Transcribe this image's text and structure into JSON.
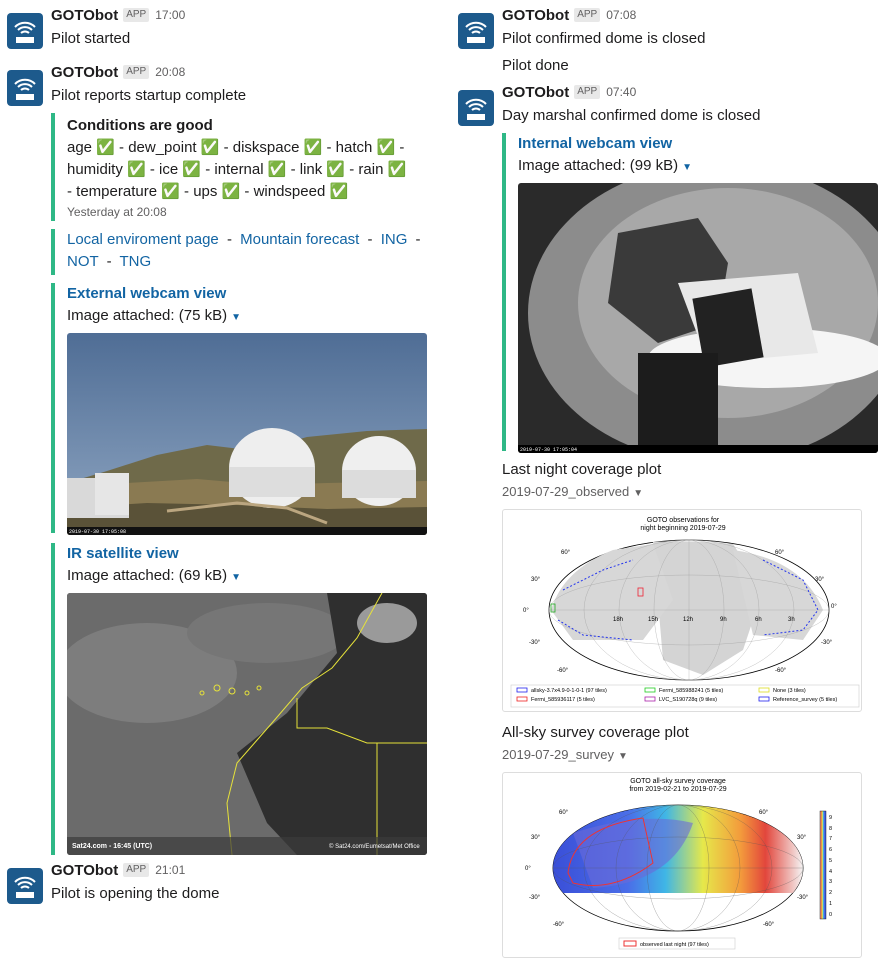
{
  "bot": {
    "name": "GOTObot",
    "badge": "APP"
  },
  "left": {
    "m1": {
      "time": "17:00",
      "text": "Pilot started"
    },
    "m2": {
      "time": "20:08",
      "text": "Pilot reports startup complete",
      "conditions": {
        "title": "Conditions are good",
        "lines": [
          "age ✅ - dew_point ✅ - diskspace ✅ - hatch ✅ -",
          "humidity ✅ - ice ✅ - internal ✅ - link ✅ - rain ✅",
          "- temperature ✅ - ups ✅ - windspeed ✅"
        ],
        "footer": "Yesterday at 20:08"
      },
      "links": {
        "l1": "Local enviroment page",
        "l2": "Mountain forecast",
        "l3": "ING",
        "l4": "NOT",
        "l5": "TNG",
        "sep": "-"
      },
      "external": {
        "title": "External webcam view",
        "caption": "Image attached: (75 kB)",
        "stamp": "2019-07-30  17:05:08"
      },
      "ir": {
        "title": "IR satellite view",
        "caption": "Image attached: (69 kB)",
        "credit_left": "Sat24.com - 16:45 (UTC)",
        "credit_right": "© Sat24.com/Eumetsat/Met Office"
      }
    },
    "m3": {
      "time": "21:01",
      "text": "Pilot is opening the dome"
    }
  },
  "right": {
    "m1": {
      "time": "07:08",
      "text": "Pilot confirmed dome is closed",
      "text2": "Pilot done"
    },
    "m2": {
      "time": "07:40",
      "text": "Day marshal confirmed dome is closed",
      "internal": {
        "title": "Internal webcam view",
        "caption": "Image attached: (99 kB)",
        "stamp": "2019-07-30  17:05:04"
      }
    },
    "plot1": {
      "title": "Last night coverage plot",
      "file": "2019-07-29_observed",
      "heading1": "GOTO observations for",
      "heading2": "night beginning 2019-07-29",
      "legend": [
        "allsky-3.7x4.9-0-1-0-1 (97 tiles)",
        "Fermi_585988241 (5 tiles)",
        "None (3 tiles)",
        "Fermi_585936117 (5 tiles)",
        "LVC_S190728q (9 tiles)",
        "Reference_survey (5 tiles)"
      ]
    },
    "plot2": {
      "title": "All-sky survey coverage plot",
      "file": "2019-07-29_survey",
      "heading1": "GOTO all-sky survey coverage",
      "heading2": "from 2019-02-21 to 2019-07-29",
      "legend": "observed last night (97 tiles)",
      "cbar": [
        "9",
        "8",
        "7",
        "6",
        "5",
        "4",
        "3",
        "2",
        "1",
        "0"
      ]
    },
    "axis": {
      "lat": [
        "60°",
        "30°",
        "0°",
        "-30°",
        "-60°"
      ],
      "lon": [
        "18h",
        "15h",
        "12h",
        "9h",
        "6h",
        "3h"
      ]
    }
  }
}
